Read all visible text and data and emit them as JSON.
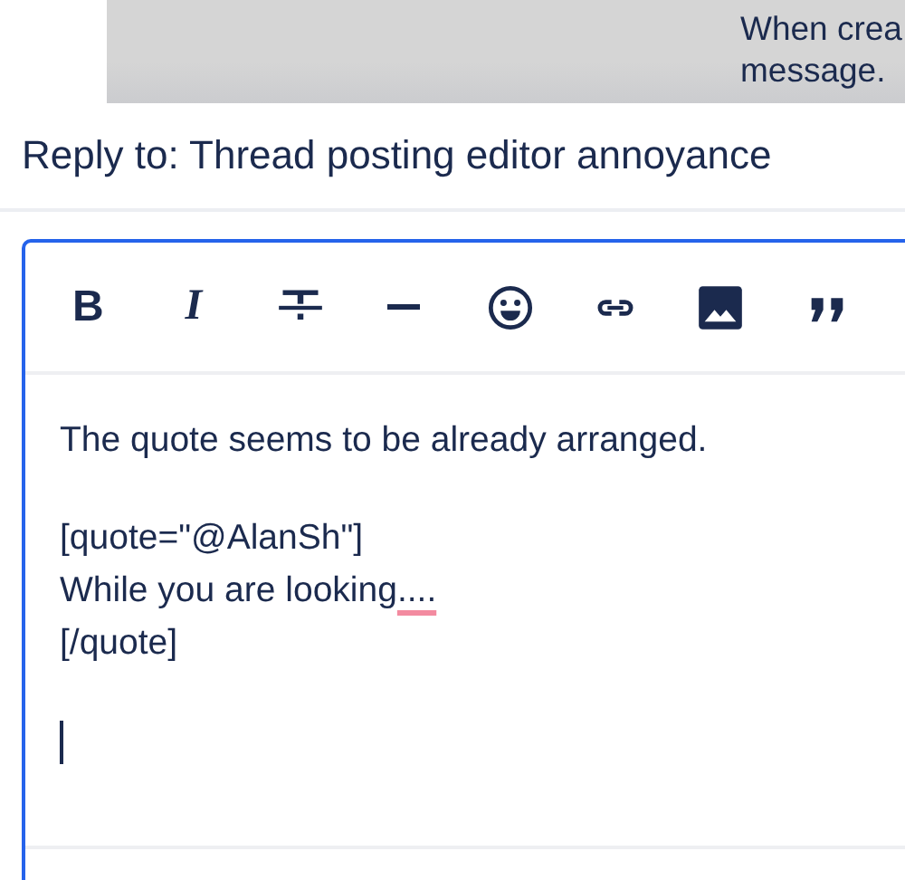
{
  "notice": {
    "lines": [
      "When crea",
      "message."
    ]
  },
  "reply": {
    "title": "Reply to: Thread posting editor annoyance"
  },
  "editor": {
    "focused": true,
    "caret": true,
    "toolbar": [
      {
        "kind": "bold",
        "label": "B"
      },
      {
        "kind": "italic",
        "label": "I"
      },
      {
        "kind": "strike"
      },
      {
        "kind": "rule"
      },
      {
        "kind": "emoji"
      },
      {
        "kind": "link"
      },
      {
        "kind": "image"
      },
      {
        "kind": "quote"
      }
    ],
    "lines": [
      {
        "kind": "text",
        "segments": [
          {
            "text": "The quote seems to be already arranged.",
            "misspelled": false
          }
        ]
      },
      {
        "kind": "blank"
      },
      {
        "kind": "text",
        "segments": [
          {
            "text": "[quote=\"@AlanSh\"]",
            "misspelled": false
          }
        ]
      },
      {
        "kind": "text",
        "segments": [
          {
            "text": "While you are looking",
            "misspelled": false
          },
          {
            "text": "....",
            "misspelled": true
          }
        ]
      },
      {
        "kind": "text",
        "segments": [
          {
            "text": "[/quote]",
            "misspelled": false
          }
        ]
      },
      {
        "kind": "blank"
      }
    ]
  }
}
